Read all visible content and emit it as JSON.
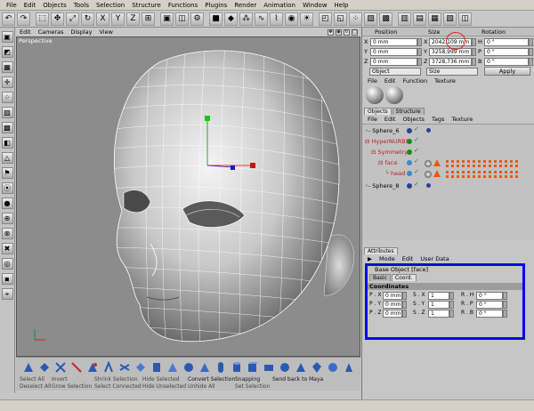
{
  "menubar": [
    "File",
    "Edit",
    "Objects",
    "Tools",
    "Selection",
    "Structure",
    "Functions",
    "Plugins",
    "Render",
    "Animation",
    "Window",
    "Help"
  ],
  "toolbar_icons": [
    "undo-icon",
    "redo-icon",
    "live-select-icon",
    "move-icon",
    "scale-icon",
    "rotate-icon",
    "x-axis-icon",
    "y-axis-icon",
    "z-axis-icon",
    "coordinate-system-icon",
    "render-view-icon",
    "render-picture-viewer-icon",
    "edit-render-settings-icon",
    "cube-icon",
    "nurbs-icon",
    "array-icon",
    "spline-icon",
    "deformer-icon",
    "scene-icon",
    "light-icon",
    "use-model-tool-icon",
    "use-object-tool-icon",
    "points-icon",
    "edges-icon",
    "polygons-icon",
    "layout-1-icon",
    "layout-2-icon",
    "layout-3-icon",
    "layout-4-icon",
    "tweak-icon"
  ],
  "viewport": {
    "menu": [
      "Edit",
      "Cameras",
      "Display",
      "View"
    ],
    "label": "Perspective"
  },
  "coordinates": {
    "headers": {
      "position": "Position",
      "size": "Size",
      "rotation": "Rotation"
    },
    "rows": [
      {
        "pos_label": "X",
        "pos": "0 mm",
        "size_label": "X",
        "size": "2042,109 mm",
        "rot_label": "H",
        "rot": "0 °"
      },
      {
        "pos_label": "Y",
        "pos": "0 mm",
        "size_label": "Y",
        "size": "3258,999 mm",
        "rot_label": "P",
        "rot": "0 °"
      },
      {
        "pos_label": "Z",
        "pos": "0 mm",
        "size_label": "Z",
        "size": "3728,736 mm",
        "rot_label": "B",
        "rot": "0 °"
      }
    ],
    "mode_left": "Object",
    "mode_right": "Size",
    "apply": "Apply"
  },
  "materials": {
    "menu": [
      "File",
      "Edit",
      "Function",
      "Texture"
    ]
  },
  "objects": {
    "tabs": [
      "Objects",
      "Structure"
    ],
    "menu": [
      "File",
      "Edit",
      "Objects",
      "Tags",
      "Texture"
    ],
    "tree": [
      {
        "name": "Sphere_6"
      },
      {
        "name": "HyperNURBS"
      },
      {
        "name": "Symmetry"
      },
      {
        "name": "face"
      },
      {
        "name": "head"
      },
      {
        "name": "Sphere_8"
      }
    ]
  },
  "attributes": {
    "tab": "Attributes",
    "menu": [
      "Mode",
      "Edit",
      "User Data"
    ],
    "object_title": "Base Object [face]",
    "subtabs": [
      "Basic",
      "Coord."
    ],
    "section": "Coordinates",
    "rows": [
      {
        "p": "P . X",
        "pv": "0 mm",
        "s": "S . X",
        "sv": "1",
        "r": "R . H",
        "rv": "0 °"
      },
      {
        "p": "P . Y",
        "pv": "0 mm",
        "s": "S . Y",
        "sv": "1",
        "r": "R . P",
        "rv": "0 °"
      },
      {
        "p": "P . Z",
        "pv": "0 mm",
        "s": "S . Z",
        "sv": "1",
        "r": "R . B",
        "rv": "0 °"
      }
    ]
  },
  "bottom_commands": {
    "row1": [
      "Select All",
      "Invert",
      "Shrink Selection",
      "Hide Selected",
      "Convert Selection",
      "Snapping",
      "Send back to Maya"
    ],
    "row2": [
      "Deselect All",
      "Grow Selection",
      "Select Connected",
      "Hide Unselected",
      "Unhide All",
      "Set Selection"
    ]
  },
  "colors": {
    "accent_blue": "#0a0ae8",
    "highlight_red": "#e02020",
    "hypernurbs_red": "#b8202a"
  }
}
